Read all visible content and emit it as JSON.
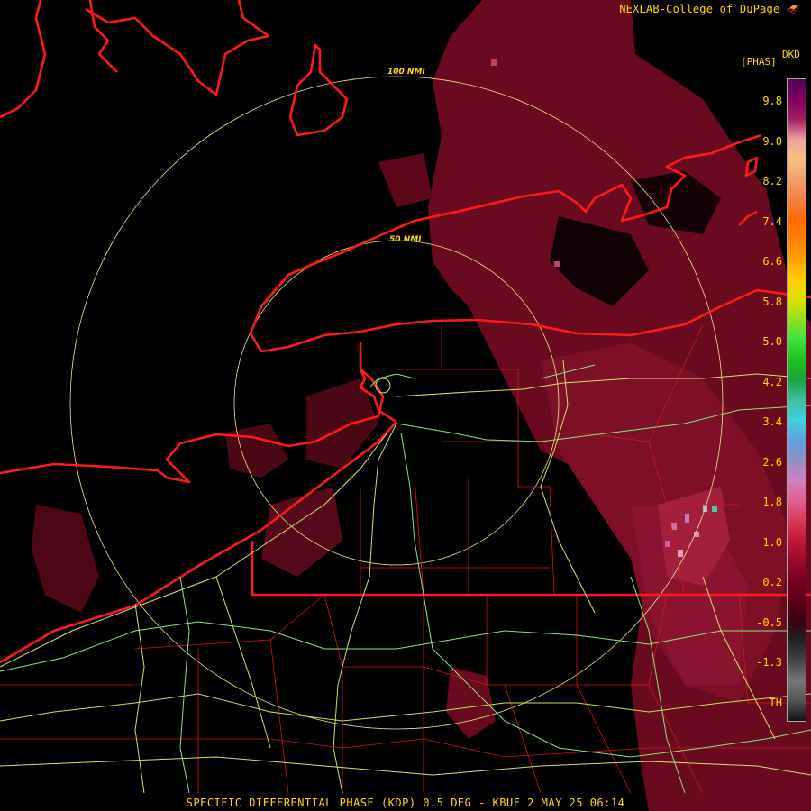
{
  "credit": "NEXLAB-College of DuPage",
  "credit_icon": "corner-arrow-icon",
  "product": {
    "code": "DKD",
    "unit": "[PHAS]",
    "footer": "SPECIFIC DIFFERENTIAL PHASE (KDP) 0.5 DEG - KBUF 2 MAY 25 06:14"
  },
  "range_rings": {
    "inner_label": "50 NMI",
    "outer_label": "100 NMI"
  },
  "colorbar": {
    "labels": [
      "9.8",
      "9.0",
      "8.2",
      "7.4",
      "6.6",
      "5.8",
      "5.0",
      "4.2",
      "3.4",
      "2.6",
      "1.8",
      "1.0",
      "0.2",
      "-0.5",
      "-1.3",
      "TH"
    ],
    "stops": [
      "#111111",
      "#555555",
      "#777777",
      "#444444",
      "#222222",
      "#3a0010",
      "#5c0018",
      "#7a0020",
      "#9a0a2a",
      "#c01838",
      "#d83a5a",
      "#e06090",
      "#d080c0",
      "#9090c0",
      "#60a0e0",
      "#40d0e0",
      "#40c0a0",
      "#20a040",
      "#20c020",
      "#40e040",
      "#90e020",
      "#e0e000",
      "#ffd000",
      "#ffa000",
      "#ff8000",
      "#ff6a00",
      "#f08040",
      "#f0a070",
      "#f8c080",
      "#f0a0a0",
      "#a02060",
      "#800060",
      "#500050"
    ],
    "colors": {
      "frame": "#aaaaaa"
    }
  },
  "colors": {
    "text": "#ffd800",
    "background": "#000000",
    "shoreline": "#ff1a1a",
    "roads": "#c8e060",
    "rings": "#f0e68c",
    "echo": "#6a0a1e"
  }
}
